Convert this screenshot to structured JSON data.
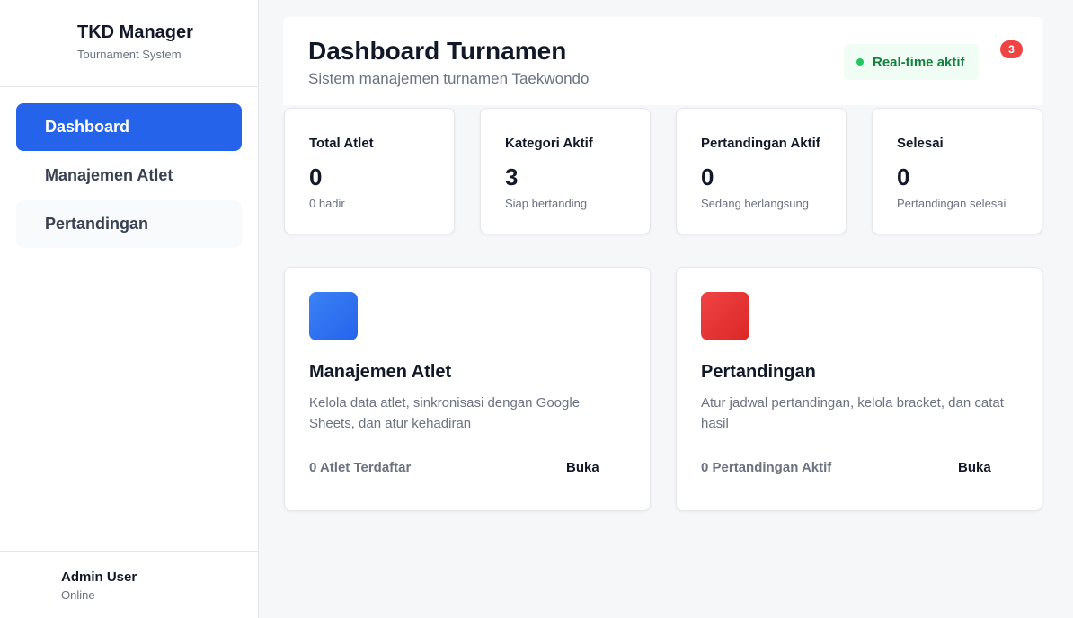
{
  "brand": {
    "title": "TKD Manager",
    "subtitle": "Tournament System"
  },
  "sidebar": {
    "items": [
      {
        "label": "Dashboard"
      },
      {
        "label": "Manajemen Atlet"
      },
      {
        "label": "Pertandingan"
      }
    ]
  },
  "user": {
    "name": "Admin User",
    "status": "Online"
  },
  "header": {
    "title": "Dashboard Turnamen",
    "subtitle": "Sistem manajemen turnamen Taekwondo",
    "realtime_label": "Real-time aktif",
    "notification_count": "3"
  },
  "stats": [
    {
      "label": "Total Atlet",
      "value": "0",
      "note": "0 hadir"
    },
    {
      "label": "Kategori Aktif",
      "value": "3",
      "note": "Siap bertanding"
    },
    {
      "label": "Pertandingan Aktif",
      "value": "0",
      "note": "Sedang berlangsung"
    },
    {
      "label": "Selesai",
      "value": "0",
      "note": "Pertandingan selesai"
    }
  ],
  "cards": [
    {
      "title": "Manajemen Atlet",
      "description": "Kelola data atlet, sinkronisasi dengan Google Sheets, dan atur kehadiran",
      "meta": "0 Atlet Terdaftar",
      "action": "Buka",
      "icon": "athlete-icon",
      "color": "#2563eb"
    },
    {
      "title": "Pertandingan",
      "description": "Atur jadwal pertandingan, kelola bracket, dan catat hasil",
      "meta": "0 Pertandingan Aktif",
      "action": "Buka",
      "icon": "match-icon",
      "color": "#dc2626"
    }
  ],
  "colors": {
    "accent": "#2563eb",
    "success": "#15803d",
    "danger": "#ef4444"
  }
}
